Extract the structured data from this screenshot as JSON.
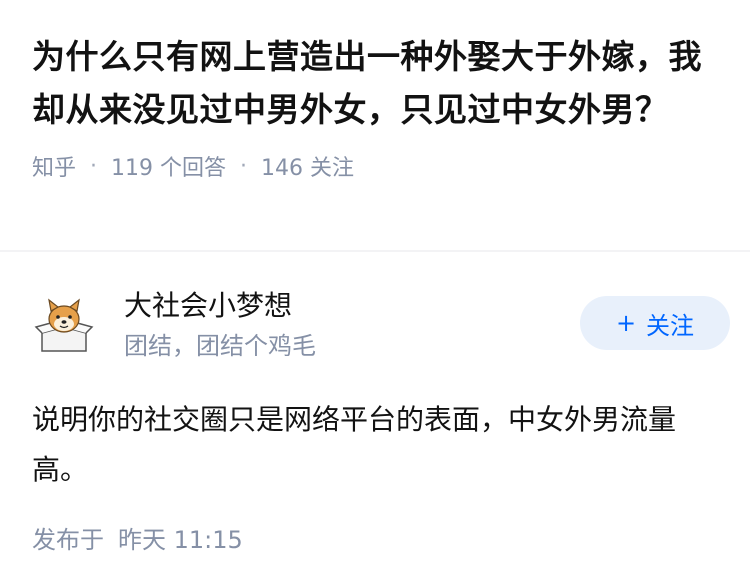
{
  "question": {
    "title": "为什么只有网上营造出一种外娶大于外嫁，我却从来没见过中男外女，只见过中女外男？",
    "source": "知乎",
    "answers_count": "119 个回答",
    "followers_count": "146 关注"
  },
  "answer": {
    "author_name": "大社会小梦想",
    "author_bio": "团结，团结个鸡毛",
    "follow_label": "关注",
    "follow_icon": "plus-icon",
    "content": "说明你的社交圈只是网络平台的表面，中女外男流量高。",
    "posted_prefix": "发布于",
    "posted_time": "昨天 11:15"
  },
  "colors": {
    "accent": "#0066ff",
    "follow_bg": "#e8f0fb",
    "meta": "#8590a6",
    "text": "#121212"
  }
}
